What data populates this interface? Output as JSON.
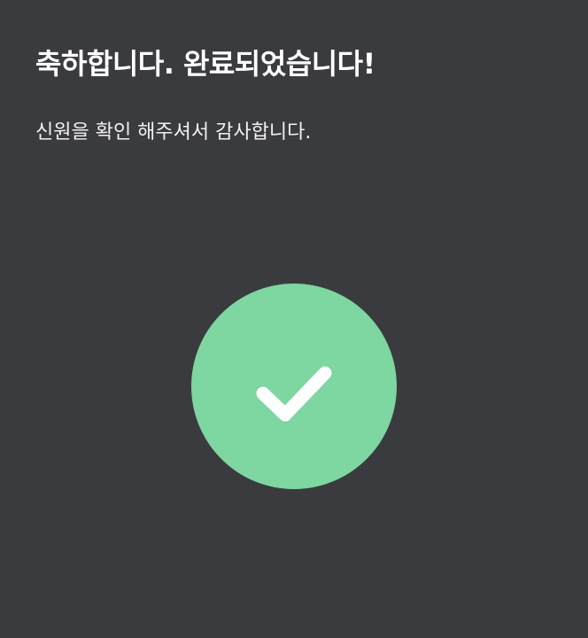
{
  "header": {
    "title": "축하합니다. 완료되었습니다!",
    "subtitle": "신원을 확인 해주셔서 감사합니다."
  },
  "status": {
    "icon": "checkmark-icon",
    "state": "success",
    "circle_color": "#7ed6a0",
    "check_color": "#ffffff"
  },
  "colors": {
    "background": "#3a3b3f",
    "text": "#ffffff"
  }
}
